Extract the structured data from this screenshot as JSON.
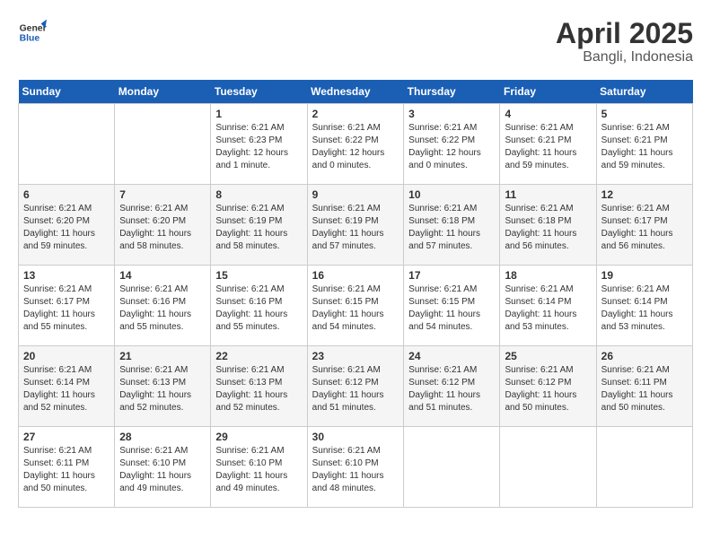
{
  "logo": {
    "line1": "General",
    "line2": "Blue"
  },
  "title": "April 2025",
  "subtitle": "Bangli, Indonesia",
  "days_header": [
    "Sunday",
    "Monday",
    "Tuesday",
    "Wednesday",
    "Thursday",
    "Friday",
    "Saturday"
  ],
  "weeks": [
    [
      {
        "day": "",
        "info": ""
      },
      {
        "day": "",
        "info": ""
      },
      {
        "day": "1",
        "info": "Sunrise: 6:21 AM\nSunset: 6:23 PM\nDaylight: 12 hours and 1 minute."
      },
      {
        "day": "2",
        "info": "Sunrise: 6:21 AM\nSunset: 6:22 PM\nDaylight: 12 hours and 0 minutes."
      },
      {
        "day": "3",
        "info": "Sunrise: 6:21 AM\nSunset: 6:22 PM\nDaylight: 12 hours and 0 minutes."
      },
      {
        "day": "4",
        "info": "Sunrise: 6:21 AM\nSunset: 6:21 PM\nDaylight: 11 hours and 59 minutes."
      },
      {
        "day": "5",
        "info": "Sunrise: 6:21 AM\nSunset: 6:21 PM\nDaylight: 11 hours and 59 minutes."
      }
    ],
    [
      {
        "day": "6",
        "info": "Sunrise: 6:21 AM\nSunset: 6:20 PM\nDaylight: 11 hours and 59 minutes."
      },
      {
        "day": "7",
        "info": "Sunrise: 6:21 AM\nSunset: 6:20 PM\nDaylight: 11 hours and 58 minutes."
      },
      {
        "day": "8",
        "info": "Sunrise: 6:21 AM\nSunset: 6:19 PM\nDaylight: 11 hours and 58 minutes."
      },
      {
        "day": "9",
        "info": "Sunrise: 6:21 AM\nSunset: 6:19 PM\nDaylight: 11 hours and 57 minutes."
      },
      {
        "day": "10",
        "info": "Sunrise: 6:21 AM\nSunset: 6:18 PM\nDaylight: 11 hours and 57 minutes."
      },
      {
        "day": "11",
        "info": "Sunrise: 6:21 AM\nSunset: 6:18 PM\nDaylight: 11 hours and 56 minutes."
      },
      {
        "day": "12",
        "info": "Sunrise: 6:21 AM\nSunset: 6:17 PM\nDaylight: 11 hours and 56 minutes."
      }
    ],
    [
      {
        "day": "13",
        "info": "Sunrise: 6:21 AM\nSunset: 6:17 PM\nDaylight: 11 hours and 55 minutes."
      },
      {
        "day": "14",
        "info": "Sunrise: 6:21 AM\nSunset: 6:16 PM\nDaylight: 11 hours and 55 minutes."
      },
      {
        "day": "15",
        "info": "Sunrise: 6:21 AM\nSunset: 6:16 PM\nDaylight: 11 hours and 55 minutes."
      },
      {
        "day": "16",
        "info": "Sunrise: 6:21 AM\nSunset: 6:15 PM\nDaylight: 11 hours and 54 minutes."
      },
      {
        "day": "17",
        "info": "Sunrise: 6:21 AM\nSunset: 6:15 PM\nDaylight: 11 hours and 54 minutes."
      },
      {
        "day": "18",
        "info": "Sunrise: 6:21 AM\nSunset: 6:14 PM\nDaylight: 11 hours and 53 minutes."
      },
      {
        "day": "19",
        "info": "Sunrise: 6:21 AM\nSunset: 6:14 PM\nDaylight: 11 hours and 53 minutes."
      }
    ],
    [
      {
        "day": "20",
        "info": "Sunrise: 6:21 AM\nSunset: 6:14 PM\nDaylight: 11 hours and 52 minutes."
      },
      {
        "day": "21",
        "info": "Sunrise: 6:21 AM\nSunset: 6:13 PM\nDaylight: 11 hours and 52 minutes."
      },
      {
        "day": "22",
        "info": "Sunrise: 6:21 AM\nSunset: 6:13 PM\nDaylight: 11 hours and 52 minutes."
      },
      {
        "day": "23",
        "info": "Sunrise: 6:21 AM\nSunset: 6:12 PM\nDaylight: 11 hours and 51 minutes."
      },
      {
        "day": "24",
        "info": "Sunrise: 6:21 AM\nSunset: 6:12 PM\nDaylight: 11 hours and 51 minutes."
      },
      {
        "day": "25",
        "info": "Sunrise: 6:21 AM\nSunset: 6:12 PM\nDaylight: 11 hours and 50 minutes."
      },
      {
        "day": "26",
        "info": "Sunrise: 6:21 AM\nSunset: 6:11 PM\nDaylight: 11 hours and 50 minutes."
      }
    ],
    [
      {
        "day": "27",
        "info": "Sunrise: 6:21 AM\nSunset: 6:11 PM\nDaylight: 11 hours and 50 minutes."
      },
      {
        "day": "28",
        "info": "Sunrise: 6:21 AM\nSunset: 6:10 PM\nDaylight: 11 hours and 49 minutes."
      },
      {
        "day": "29",
        "info": "Sunrise: 6:21 AM\nSunset: 6:10 PM\nDaylight: 11 hours and 49 minutes."
      },
      {
        "day": "30",
        "info": "Sunrise: 6:21 AM\nSunset: 6:10 PM\nDaylight: 11 hours and 48 minutes."
      },
      {
        "day": "",
        "info": ""
      },
      {
        "day": "",
        "info": ""
      },
      {
        "day": "",
        "info": ""
      }
    ]
  ]
}
